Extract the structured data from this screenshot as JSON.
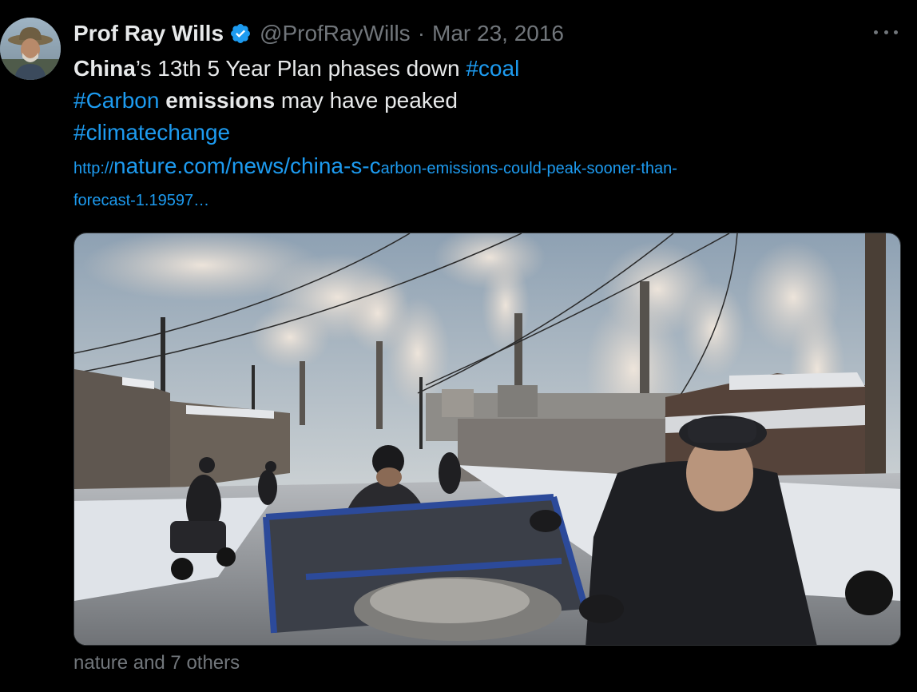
{
  "author": {
    "display_name": "Prof Ray Wills",
    "handle": "@ProfRayWills",
    "separator": "·",
    "date": "Mar 23, 2016",
    "verified": true,
    "avatar_icon": "profile-photo-person-with-hat"
  },
  "tweet": {
    "line1": {
      "bold": "China",
      "text": "’s 13th 5 Year Plan phases down ",
      "hashtag": "#coal"
    },
    "line2": {
      "hashtag": "#Carbon",
      "space": " ",
      "bold": "emissions",
      "text": " may have peaked"
    },
    "line3": {
      "hashtag": "#climatechange"
    },
    "link": {
      "prefix": "http://",
      "large": "nature.com/news/china-s-c",
      "rest": "arbon-emissions-could-peak-sooner-than-",
      "line2": "forecast-1.19597…"
    }
  },
  "media": {
    "description_icon": "photo-coal-power-plant-smokestacks-street-scene"
  },
  "footer": {
    "text": "nature and 7 others"
  },
  "colors": {
    "background": "#000000",
    "text": "#e7e9ea",
    "secondary": "#71767b",
    "accent": "#1d9bf0"
  }
}
